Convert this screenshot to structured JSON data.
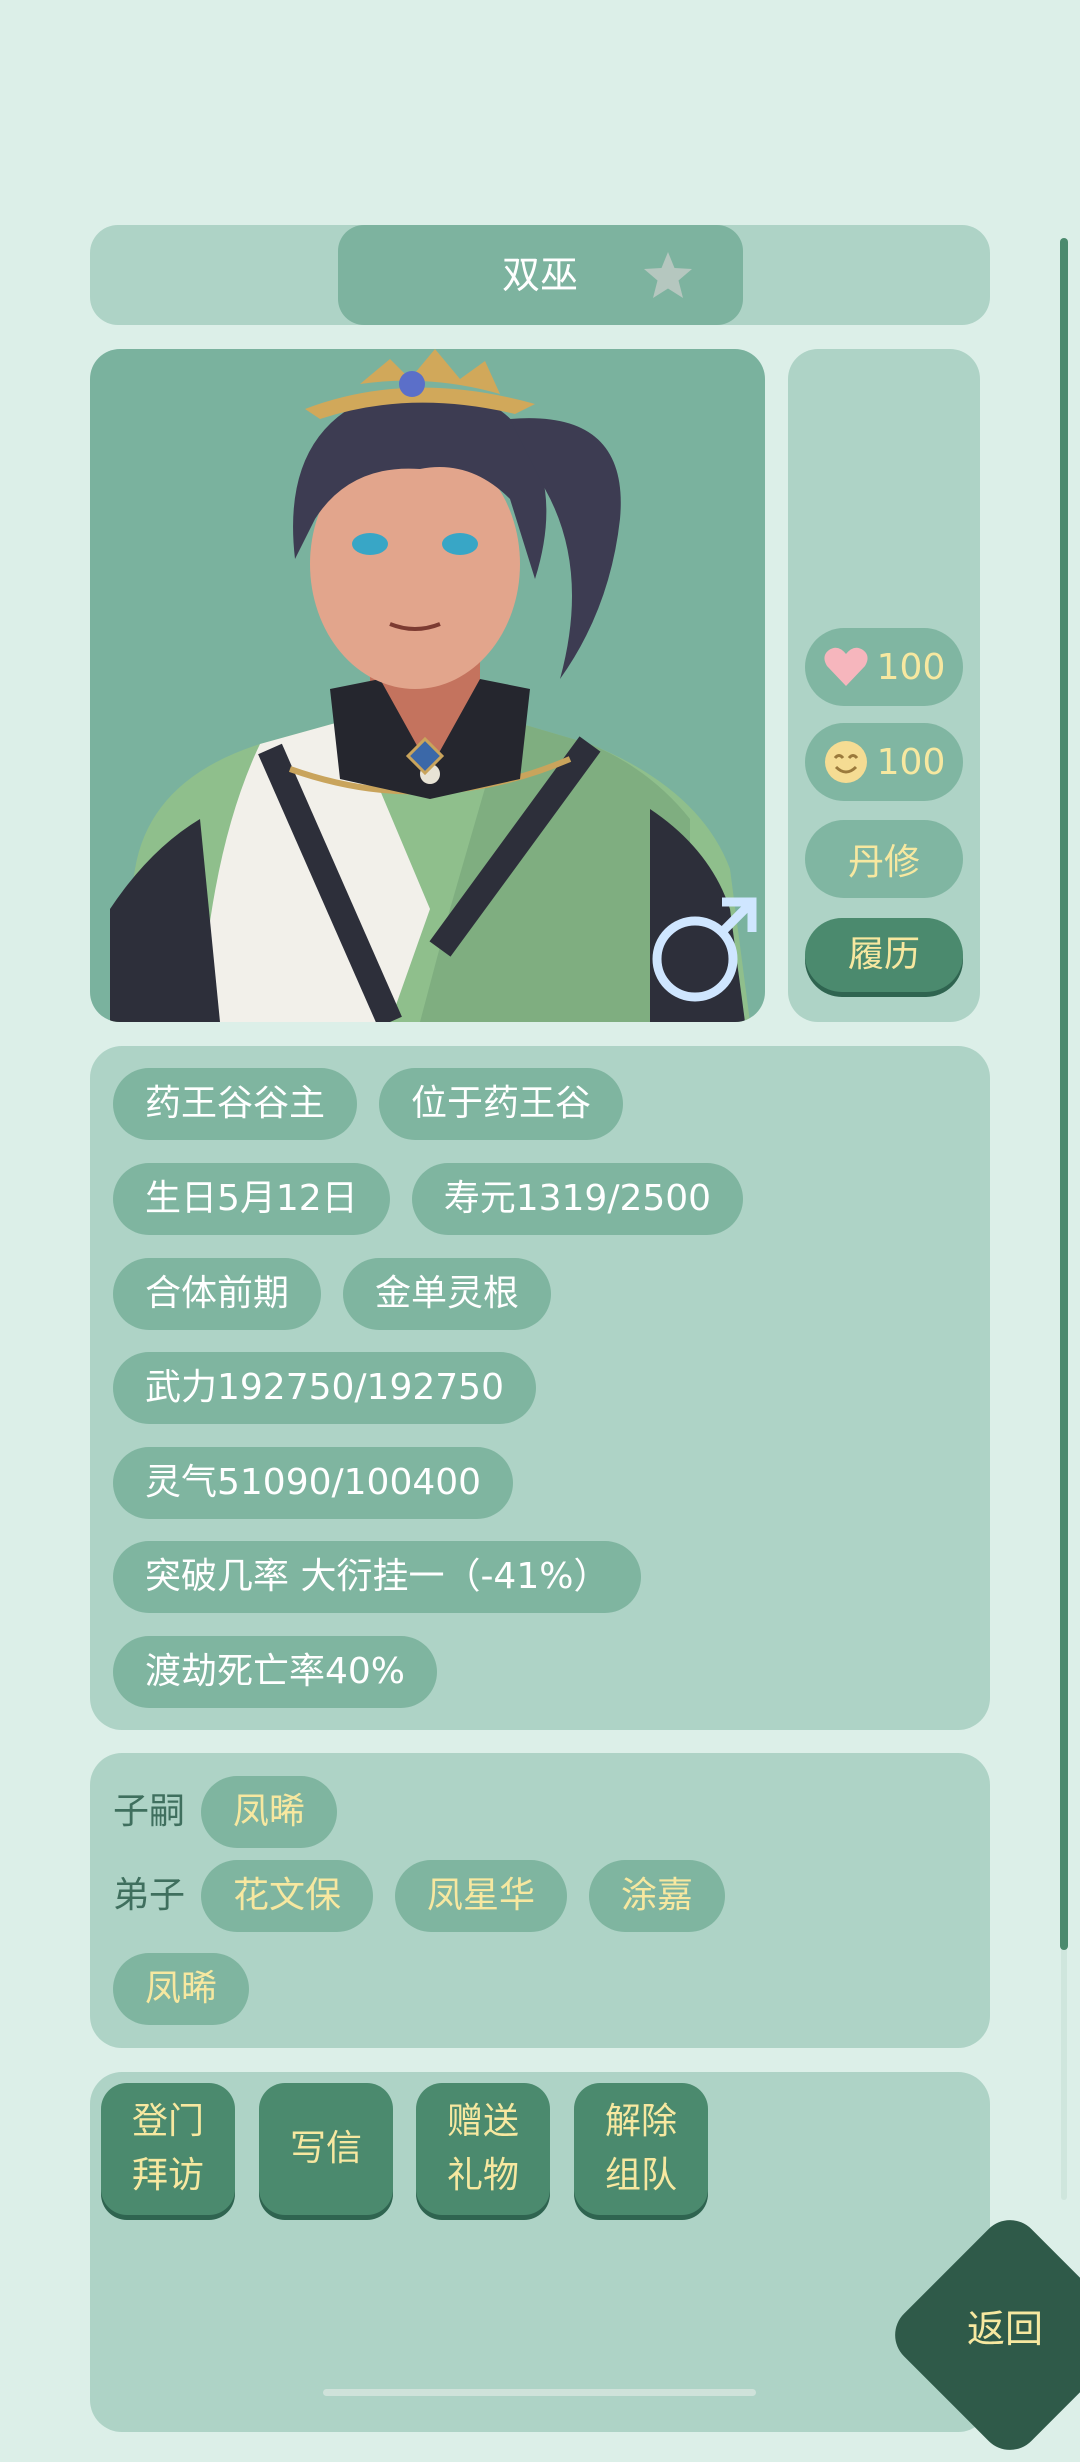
{
  "header": {
    "name": "双巫"
  },
  "stats": {
    "favor": "100",
    "mood": "100",
    "profession": "丹修",
    "resume": "履历"
  },
  "info_tags": [
    [
      "药王谷谷主",
      "位于药王谷"
    ],
    [
      "生日5月12日",
      "寿元1319/2500"
    ],
    [
      "合体前期",
      "金单灵根"
    ],
    [
      "武力192750/192750"
    ],
    [
      "灵气51090/100400"
    ],
    [
      "突破几率 大衍挂一（-41%）"
    ],
    [
      "渡劫死亡率40%"
    ]
  ],
  "relations": {
    "children_label": "子嗣",
    "children": [
      "凤晞"
    ],
    "disciples_label": "弟子",
    "disciples": [
      "花文保",
      "凤星华",
      "涂嘉",
      "凤晞"
    ]
  },
  "actions": {
    "visit": [
      "登门",
      "拜访"
    ],
    "letter": "写信",
    "gift": [
      "赠送",
      "礼物"
    ],
    "disband": [
      "解除",
      "组队"
    ]
  },
  "back_label": "返回",
  "colors": {
    "bg": "#dcefe8",
    "panel": "#aed3c6",
    "pill": "#7fb5a0",
    "accent": "#4b8a6e",
    "gold": "#f7e8a0",
    "back": "#2f5a49"
  },
  "icons": {
    "favorite": "star-icon",
    "favor": "heart-icon",
    "mood": "smile-face-icon",
    "gender": "male-symbol-icon"
  }
}
